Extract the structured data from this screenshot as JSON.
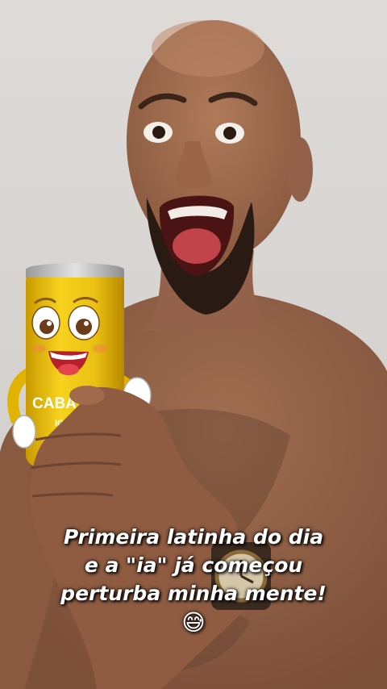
{
  "caption": {
    "line1": "Primeira latinha do dia",
    "line2": "e a \"ia\" já começou",
    "line3": "perturba minha mente!",
    "emoji": "😅"
  },
  "can": {
    "brand_text": "CABA",
    "sub_text": "ICE"
  },
  "icons": {
    "emoji": "sweat-smile-emoji"
  }
}
